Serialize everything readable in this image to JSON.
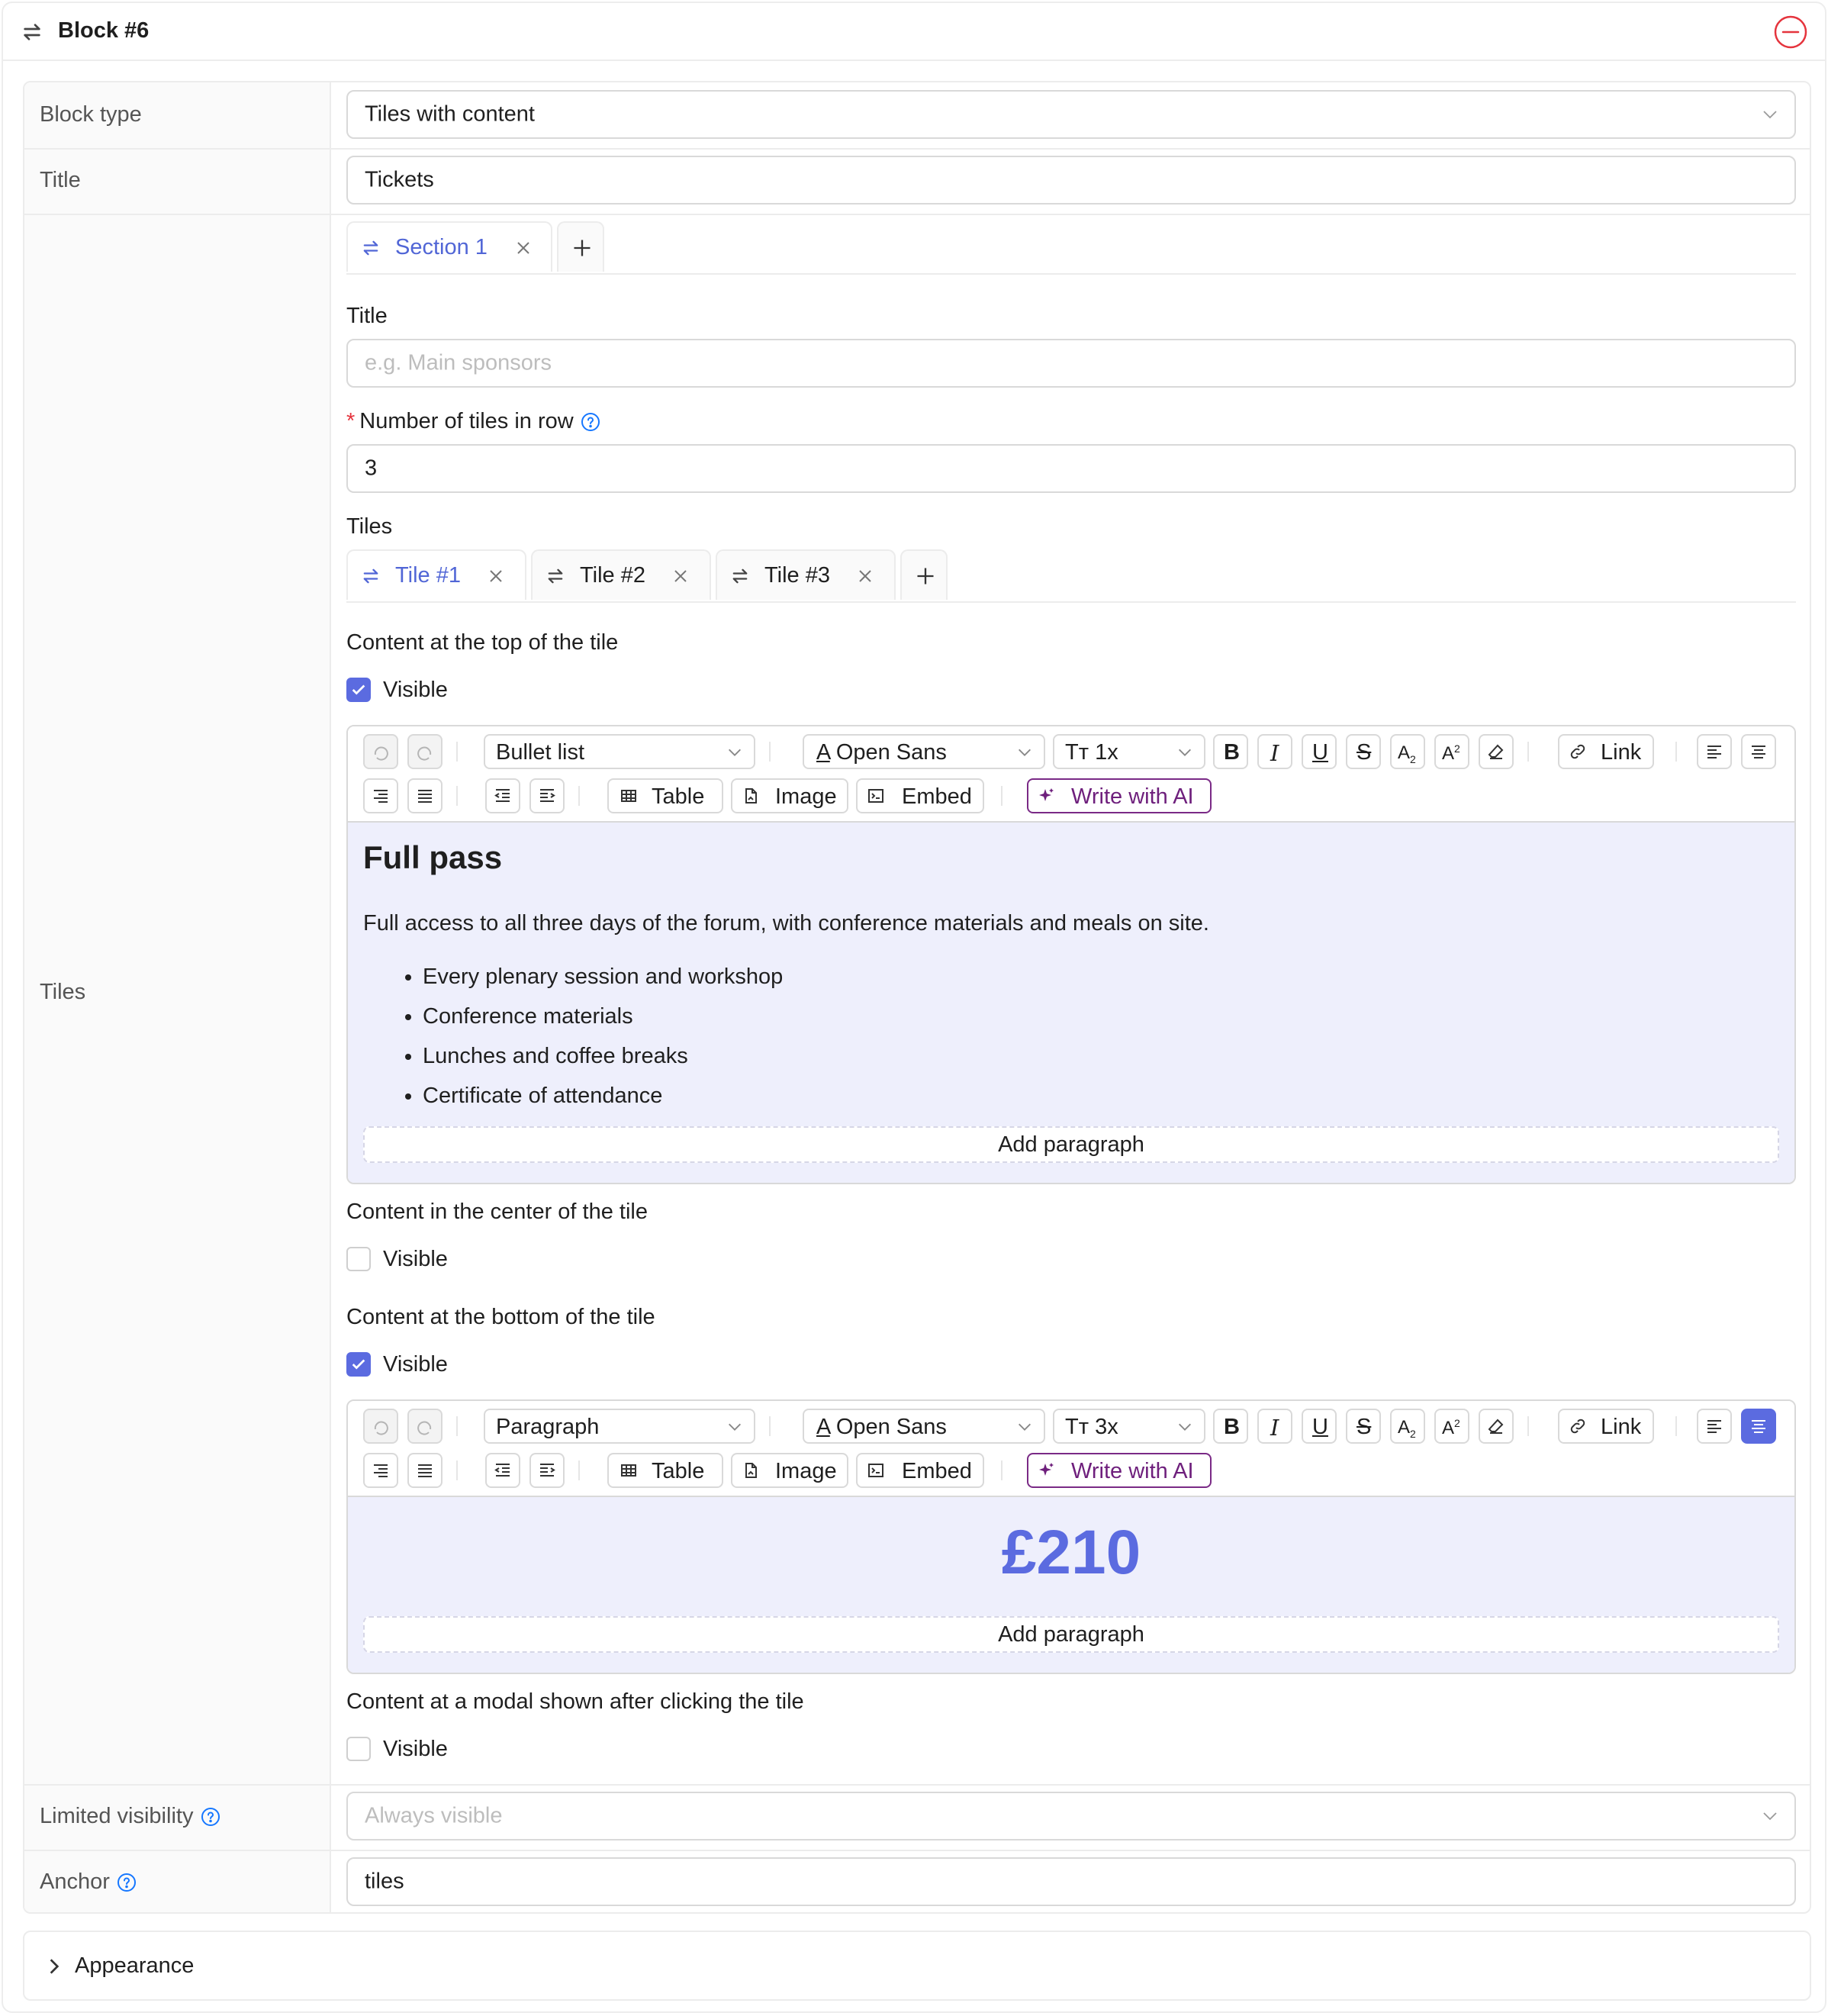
{
  "header": {
    "title": "Block #6"
  },
  "rows": {
    "block_type": {
      "label": "Block type",
      "value": "Tiles with content"
    },
    "title": {
      "label": "Title",
      "value": "Tickets"
    },
    "tiles": {
      "label": "Tiles"
    },
    "limited_visibility": {
      "label": "Limited visibility",
      "placeholder": "Always visible"
    },
    "anchor": {
      "label": "Anchor",
      "value": "tiles"
    }
  },
  "sections": {
    "tabs": [
      {
        "label": "Section 1"
      }
    ],
    "title_label": "Title",
    "title_placeholder": "e.g. Main sponsors",
    "tiles_in_row_label": "Number of tiles in row",
    "tiles_in_row_value": "3",
    "tiles_label": "Tiles",
    "tile_tabs": [
      {
        "label": "Tile #1"
      },
      {
        "label": "Tile #2"
      },
      {
        "label": "Tile #3"
      }
    ]
  },
  "tile": {
    "top": {
      "label": "Content at the top of the tile",
      "visible_label": "Visible",
      "visible": true
    },
    "center": {
      "label": "Content in the center of the tile",
      "visible_label": "Visible",
      "visible": false
    },
    "bottom": {
      "label": "Content at the bottom of the tile",
      "visible_label": "Visible",
      "visible": true
    },
    "modal": {
      "label": "Content at a modal shown after clicking the tile",
      "visible_label": "Visible",
      "visible": false
    }
  },
  "editor_top": {
    "block_style": "Bullet list",
    "font": "Open Sans",
    "size": "1x",
    "link": "Link",
    "table": "Table",
    "image": "Image",
    "embed": "Embed",
    "ai": "Write with AI",
    "heading": "Full pass",
    "paragraph": "Full access to all three days of the forum, with conference materials and meals on site.",
    "bullets": [
      "Every plenary session and workshop",
      "Conference materials",
      "Lunches and coffee breaks",
      "Certificate of attendance"
    ],
    "add_paragraph": "Add paragraph"
  },
  "editor_bottom": {
    "block_style": "Paragraph",
    "font": "Open Sans",
    "size": "3x",
    "link": "Link",
    "table": "Table",
    "image": "Image",
    "embed": "Embed",
    "ai": "Write with AI",
    "price": "£210",
    "add_paragraph": "Add paragraph"
  },
  "appearance": {
    "label": "Appearance"
  },
  "colors": {
    "accent": "#5b6be0",
    "tab_active": "#5166d6",
    "danger": "#e5343d",
    "ai": "#7a2a86",
    "editor_bg": "#eeeffc"
  }
}
